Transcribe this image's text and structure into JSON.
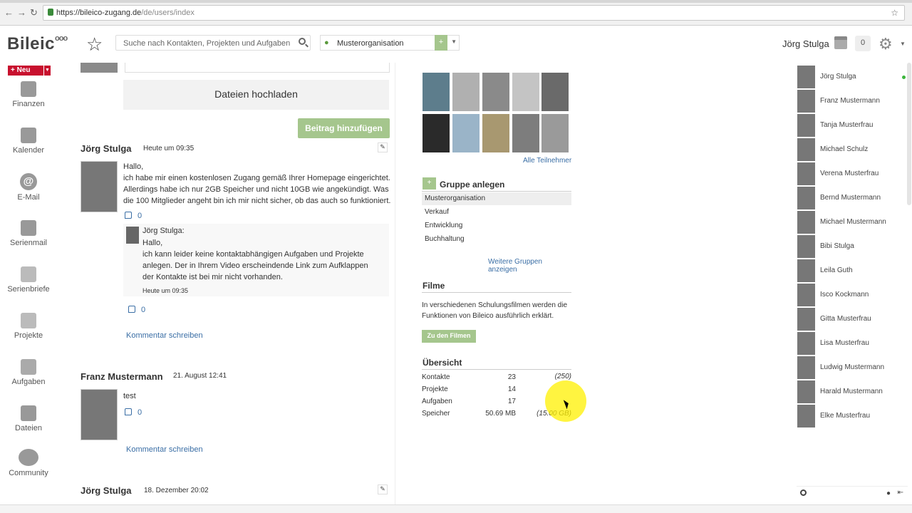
{
  "browser": {
    "url_host": "https://bileico-zugang.de",
    "url_path": "/de/users/index"
  },
  "header": {
    "logo": "Bileic",
    "logo_dots": "ooo",
    "search_placeholder": "Suche nach Kontakten, Projekten und Aufgaben",
    "org": "Musterorganisation",
    "org_add": "+",
    "user_name": "Jörg Stulga",
    "notification_count": "0"
  },
  "nav": {
    "new_label": "+ Neu",
    "items": [
      {
        "label": "Finanzen",
        "icon": "wallet-icon"
      },
      {
        "label": "Kalender",
        "icon": "calendar-icon"
      },
      {
        "label": "E-Mail",
        "icon": "at-icon"
      },
      {
        "label": "Serienmail",
        "icon": "mail-check-icon"
      },
      {
        "label": "Serienbriefe",
        "icon": "envelope-icon"
      },
      {
        "label": "Projekte",
        "icon": "folder-icon"
      },
      {
        "label": "Aufgaben",
        "icon": "tasks-icon"
      },
      {
        "label": "Dateien",
        "icon": "files-icon"
      },
      {
        "label": "Community",
        "icon": "community-icon"
      }
    ]
  },
  "feed": {
    "upload_label": "Dateien hochladen",
    "post_button": "Beitrag hinzufügen",
    "posts": [
      {
        "author": "Jörg Stulga",
        "time": "Heute um 09:35",
        "lines": [
          "Hallo,",
          "ich habe mir einen kostenlosen Zugang gemäß Ihrer Homepage eingerichtet.",
          "Allerdings habe ich nur 2GB Speicher und nicht 10GB wie angekündigt. Was",
          "die 100 Mitglieder angeht bin ich mir nicht sicher, ob das auch so funktioniert."
        ],
        "likes": "0",
        "comment": {
          "author": "Jörg Stulga:",
          "lines": [
            "Hallo,",
            "ich kann leider keine kontaktabhängigen Aufgaben und Projekte",
            "anlegen. Der in Ihrem Video erscheindende Link zum Aufklappen",
            "der Kontakte ist bei mir nicht vorhanden."
          ],
          "time": "Heute um 09:35",
          "likes": "0"
        },
        "comment_link": "Kommentar schreiben"
      },
      {
        "author": "Franz Mustermann",
        "time": "21. August 12:41",
        "text": "test",
        "likes": "0",
        "comment_link": "Kommentar schreiben"
      },
      {
        "author": "Jörg Stulga",
        "time": "18. Dezember 20:02"
      }
    ]
  },
  "members": {
    "all_link": "Alle Teilnehmer"
  },
  "groups": {
    "add_label": "+",
    "title": "Gruppe anlegen",
    "items": [
      "Musterorganisation",
      "Verkauf",
      "Entwicklung",
      "Buchhaltung"
    ],
    "more_link": "Weitere Gruppen anzeigen"
  },
  "films": {
    "title": "Filme",
    "text_line1": "In verschiedenen Schulungsfilmen werden die",
    "text_line2": "Funktionen von Bileico ausführlich erklärt.",
    "button": "Zu den Filmen"
  },
  "overview": {
    "title": "Übersicht",
    "rows": [
      {
        "label": "Kontakte",
        "value": "23",
        "limit": "(250)"
      },
      {
        "label": "Projekte",
        "value": "14",
        "limit": ""
      },
      {
        "label": "Aufgaben",
        "value": "17",
        "limit": ""
      },
      {
        "label": "Speicher",
        "value": "50.69 MB",
        "limit": "(15.00 GB)"
      }
    ]
  },
  "contacts": [
    {
      "name": "Jörg Stulga",
      "online": true
    },
    {
      "name": "Franz Mustermann"
    },
    {
      "name": "Tanja Musterfrau"
    },
    {
      "name": "Michael Schulz"
    },
    {
      "name": "Verena Musterfrau"
    },
    {
      "name": "Bernd Mustermann"
    },
    {
      "name": "Michael Mustermann"
    },
    {
      "name": "Bibi Stulga"
    },
    {
      "name": "Leila Guth"
    },
    {
      "name": "Isco Kockmann"
    },
    {
      "name": "Gitta Musterfrau"
    },
    {
      "name": "Lisa Musterfrau"
    },
    {
      "name": "Ludwig Mustermann"
    },
    {
      "name": "Harald Mustermann"
    },
    {
      "name": "Elke Musterfrau"
    }
  ],
  "colors": {
    "accent_green": "#a5c68d",
    "link_blue": "#3a6ea5",
    "new_red": "#c8102e",
    "online_green": "#3bb53b"
  }
}
